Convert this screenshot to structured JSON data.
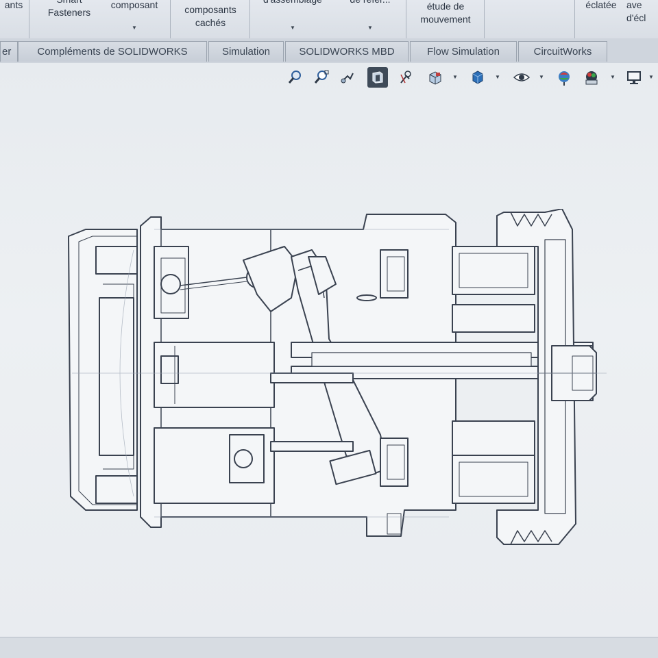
{
  "ribbon": {
    "buttons": [
      {
        "line1": "ants",
        "line2": ""
      },
      {
        "line1": "Smart",
        "line2": "Fasteners"
      },
      {
        "line1": "composant",
        "line2": ""
      },
      {
        "line1": "composants",
        "line2": "cachés"
      },
      {
        "line1": "d'assemblage",
        "line2": ""
      },
      {
        "line1": "de référ...",
        "line2": ""
      },
      {
        "line1": "étude de",
        "line2": "mouvement"
      },
      {
        "line1": "éclatée",
        "line2": ""
      },
      {
        "line1": "ave",
        "line2": "d'écl"
      }
    ]
  },
  "tabs": [
    {
      "label": "er"
    },
    {
      "label": "Compléments de SOLIDWORKS"
    },
    {
      "label": "Simulation"
    },
    {
      "label": "SOLIDWORKS MBD"
    },
    {
      "label": "Flow Simulation"
    },
    {
      "label": "CircuitWorks"
    }
  ],
  "heads_up_toolbar": {
    "icons": [
      "zoom-to-fit-icon",
      "zoom-to-area-icon",
      "previous-view-icon",
      "section-view-icon",
      "dynamic-annotation-views-icon",
      "view-orientation-icon",
      "display-style-icon",
      "hide-show-items-icon",
      "edit-appearance-icon",
      "apply-scene-icon",
      "view-settings-icon"
    ],
    "active_icon": "section-view-icon"
  },
  "colors": {
    "viewport_background": "#eceff2",
    "model_line": "#3a4250",
    "model_fill": "#f4f6f8"
  }
}
